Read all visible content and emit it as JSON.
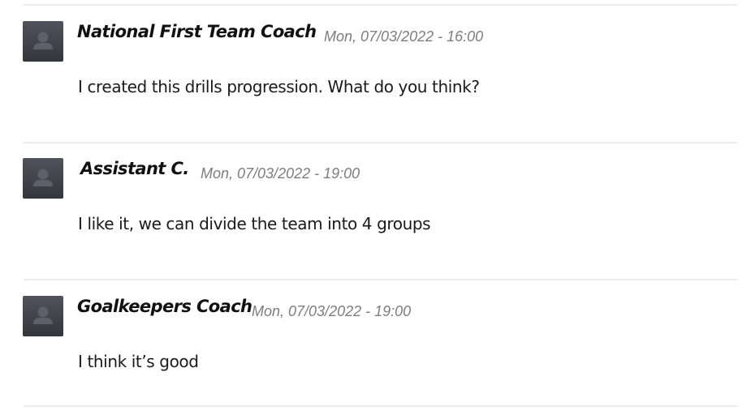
{
  "comments": [
    {
      "author": "National First Team Coach",
      "timestamp": "Mon, 07/03/2022 - 16:00",
      "text": "I created this drills progression. What do you think?",
      "avatar_icon": "user-silhouette-icon"
    },
    {
      "author": "Assistant C.",
      "timestamp": "Mon, 07/03/2022 - 19:00",
      "text": "I like it, we can divide the team into 4 groups",
      "avatar_icon": "user-silhouette-icon"
    },
    {
      "author": "Goalkeepers Coach",
      "timestamp": "Mon, 07/03/2022 - 19:00",
      "text": "I think it’s good",
      "avatar_icon": "user-silhouette-icon"
    }
  ],
  "colors": {
    "author": "#111111",
    "timestamp": "#7d7d7d",
    "body": "#1a1a1a",
    "divider": "#ececec",
    "avatar_bg": "#3e4047",
    "avatar_figure": "#5d6068"
  }
}
